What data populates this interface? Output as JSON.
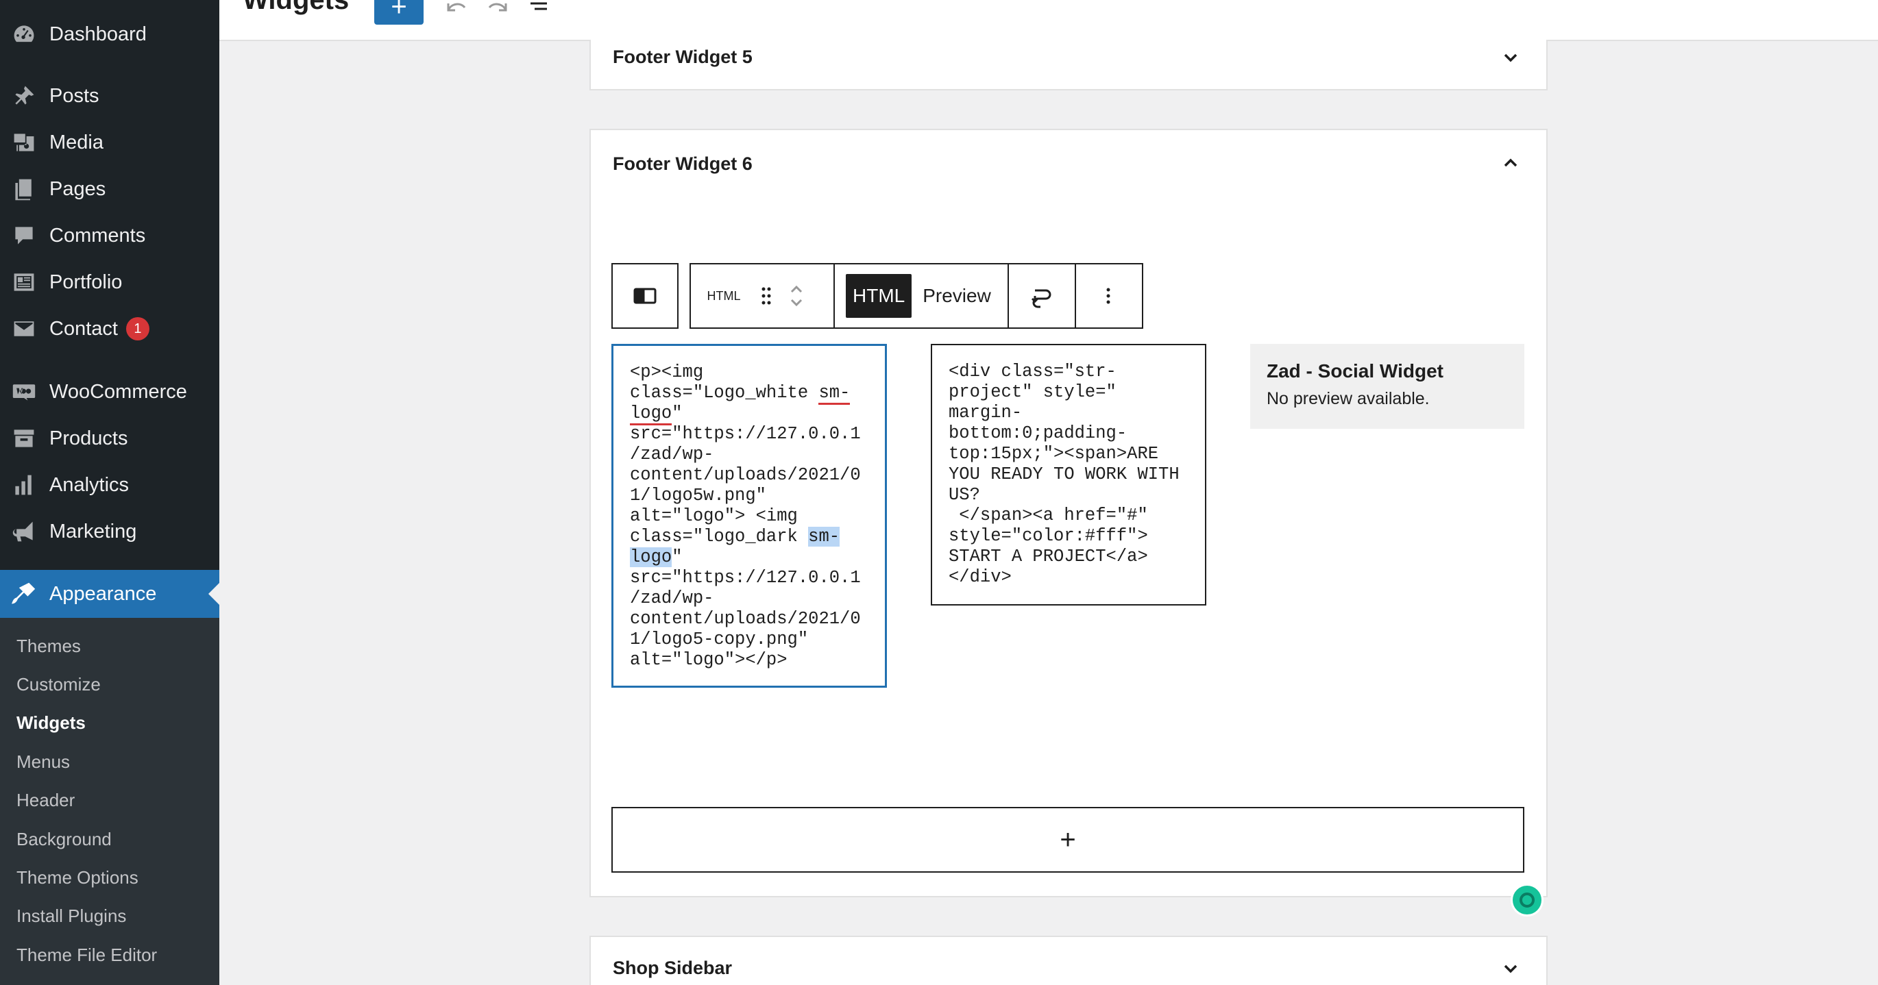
{
  "header": {
    "title": "Widgets",
    "add_label": "+"
  },
  "sidebar": {
    "items": [
      {
        "label": "Dashboard",
        "icon": "dashboard-icon"
      },
      {
        "label": "Posts",
        "icon": "pin-icon"
      },
      {
        "label": "Media",
        "icon": "media-icon"
      },
      {
        "label": "Pages",
        "icon": "pages-icon"
      },
      {
        "label": "Comments",
        "icon": "comment-icon"
      },
      {
        "label": "Portfolio",
        "icon": "portfolio-icon"
      },
      {
        "label": "Contact",
        "icon": "mail-icon",
        "badge": "1"
      },
      {
        "label": "WooCommerce",
        "icon": "woo-icon"
      },
      {
        "label": "Products",
        "icon": "archive-icon"
      },
      {
        "label": "Analytics",
        "icon": "bar-chart-icon"
      },
      {
        "label": "Marketing",
        "icon": "megaphone-icon"
      },
      {
        "label": "Appearance",
        "icon": "brush-icon"
      }
    ],
    "submenu": [
      "Themes",
      "Customize",
      "Widgets",
      "Menus",
      "Header",
      "Background",
      "Theme Options",
      "Install Plugins",
      "Theme File Editor"
    ],
    "current_submenu": "Widgets"
  },
  "widget_areas": {
    "footer5": "Footer Widget 5",
    "footer6": "Footer Widget 6",
    "shop": "Shop Sidebar"
  },
  "toolbar": {
    "block_type_label": "HTML",
    "html_tab": "HTML",
    "preview_tab": "Preview"
  },
  "code_block_1": {
    "part1": "<p><img\nclass=\"Logo_white ",
    "squig1": "sm-",
    "nl": "\n",
    "squig2": "logo",
    "part2": "\"\nsrc=\"https://127.0.0.1\n/zad/wp-\ncontent/uploads/2021/0\n1/logo5w.png\"\nalt=\"logo\"> <img\nclass=\"logo_dark ",
    "sel1": "sm-",
    "sel2": "logo",
    "part3": "\"\nsrc=\"https://127.0.0.1\n/zad/wp-\ncontent/uploads/2021/0\n1/logo5-copy.png\"\nalt=\"logo\"></p>"
  },
  "code_block_2": {
    "text": "<div class=\"str-\nproject\" style=\"\nmargin-\nbottom:0;padding-\ntop:15px;\"><span>ARE\nYOU READY TO WORK WITH\nUS?\n </span><a href=\"#\"\nstyle=\"color:#fff\">\nSTART A PROJECT</a>\n</div>"
  },
  "preview": {
    "title": "Zad - Social Widget",
    "text": "No preview available."
  },
  "appender_label": "+"
}
